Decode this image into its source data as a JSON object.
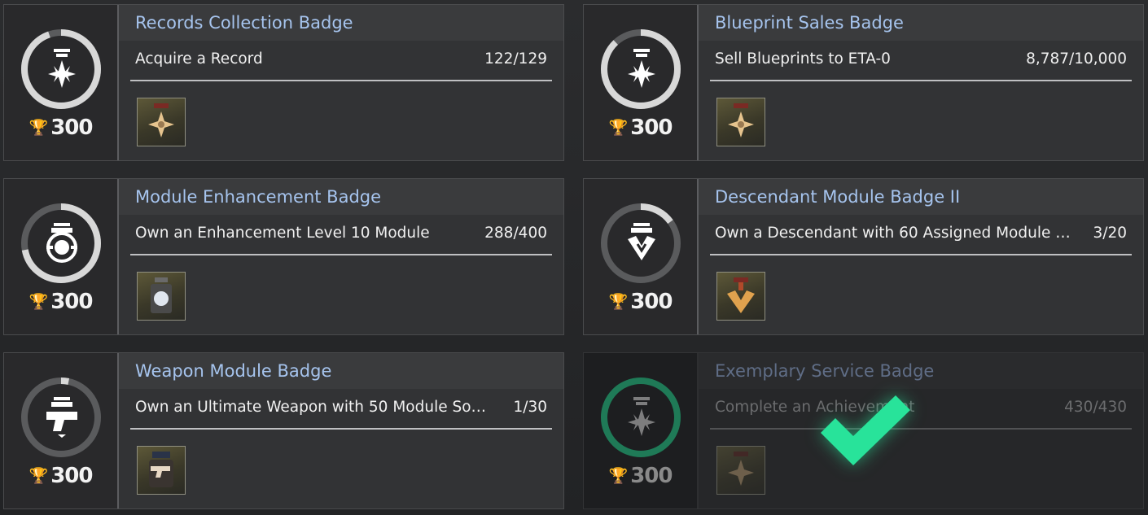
{
  "colors": {
    "title_text": "#a6c4ee",
    "ring_track": "#5a5b5d",
    "ring_fill": "#d8d8d8",
    "ring_complete": "#1f7a57",
    "check": "#28e39a"
  },
  "badges": [
    {
      "title": "Records Collection Badge",
      "task": "Acquire a Record",
      "progress_text": "122/129",
      "progress": 0.946,
      "points": "300",
      "emblem_icon": "star-medal-icon",
      "completed": false
    },
    {
      "title": "Blueprint Sales Badge",
      "task": "Sell Blueprints to ETA-0",
      "progress_text": "8,787/10,000",
      "progress": 0.879,
      "points": "300",
      "emblem_icon": "star-medal-icon",
      "completed": false
    },
    {
      "title": "Module Enhancement Badge",
      "task": "Own an Enhancement Level 10 Module",
      "progress_text": "288/400",
      "progress": 0.72,
      "points": "300",
      "emblem_icon": "gear-medal-icon",
      "completed": false
    },
    {
      "title": "Descendant Module Badge II",
      "task": "Own a Descendant with 60 Assigned Module So…",
      "progress_text": "3/20",
      "progress": 0.15,
      "points": "300",
      "emblem_icon": "chevron-medal-icon",
      "completed": false
    },
    {
      "title": "Weapon Module Badge",
      "task": "Own an Ultimate Weapon with 50 Module Sock…",
      "progress_text": "1/30",
      "progress": 0.033,
      "points": "300",
      "emblem_icon": "pistol-medal-icon",
      "completed": false
    },
    {
      "title": "Exemplary Service Badge",
      "task": "Complete an Achievement",
      "progress_text": "430/430",
      "progress": 1.0,
      "points": "300",
      "emblem_icon": "star-medal-icon",
      "completed": true
    }
  ],
  "icons": {
    "trophy": "trophy-icon",
    "completed": "checkmark-icon"
  }
}
